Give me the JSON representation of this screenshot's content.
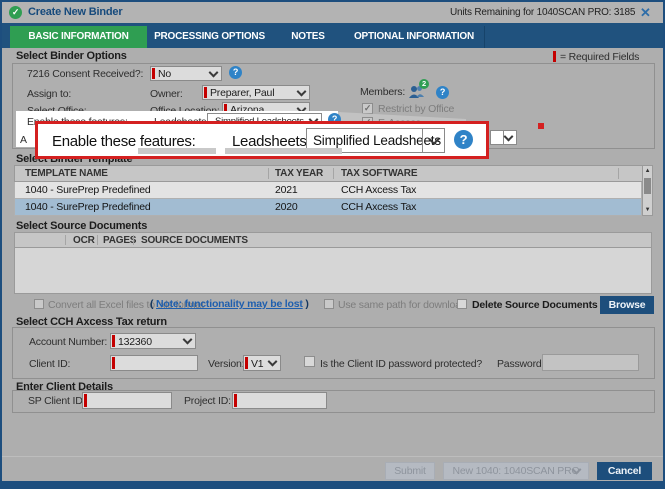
{
  "window": {
    "title": "Create New Binder",
    "units_label": "Units Remaining for 1040SCAN PRO: 3185",
    "close_glyph": "✕",
    "check_glyph": "✓"
  },
  "tabs": {
    "basic": "BASIC INFORMATION",
    "processing": "PROCESSING OPTIONS",
    "notes": "NOTES",
    "optional": "OPTIONAL INFORMATION"
  },
  "binder_options": {
    "heading": "Select Binder Options",
    "required_legend": "= Required Fields",
    "consent_label": "7216 Consent Received?:",
    "consent_value": "No",
    "assign_label": "Assign to:",
    "owner_label": "Owner:",
    "owner_value": "Preparer, Paul",
    "members_label": "Members:",
    "members_count": "2",
    "office_label": "Select Office:",
    "office_location_label": "Office Location:",
    "office_value": "Arizona",
    "restrict_label": "Restrict by Office",
    "features_label": "Enable these features:",
    "leadsheets_label": "Leadsheets:",
    "leadsheets_value": "Simplified Leadsheets",
    "eaccess_label": "E-Access",
    "hidden_row_fragment": "A",
    "check_glyph": "✓"
  },
  "callout": {
    "features_label": "Enable these features:",
    "leadsheets_label": "Leadsheets:",
    "leadsheets_value": "Simplified Leadsheets",
    "help_glyph": "?"
  },
  "template_section": {
    "heading": "Select Binder Template",
    "columns": {
      "name": "TEMPLATE NAME",
      "year": "TAX YEAR",
      "software": "TAX SOFTWARE"
    },
    "rows": [
      {
        "name": "1040 - SurePrep Predefined",
        "year": "2021",
        "software": "CCH Axcess Tax"
      },
      {
        "name": "1040 - SurePrep Predefined",
        "year": "2020",
        "software": "CCH Axcess Tax"
      }
    ],
    "selected_row_index": 1,
    "scroll_up_glyph": "▲",
    "scroll_down_glyph": "▼"
  },
  "source_section": {
    "heading": "Select Source Documents",
    "columns": {
      "ocr": "OCR",
      "pages": "PAGES",
      "docs": "SOURCE DOCUMENTS"
    },
    "convert_label": "Convert all Excel files to .xls format",
    "note_open": "(",
    "note_link": "Note: functionality may be lost",
    "note_close": ")",
    "samepath_label": "Use same path for download",
    "delete_label": "Delete Source Documents",
    "browse_label": "Browse"
  },
  "tax_return_section": {
    "heading": "Select CCH Axcess Tax return",
    "account_label": "Account Number:",
    "account_value": "132360",
    "client_id_label": "Client ID:",
    "version_label": "Version:",
    "version_value": "V1",
    "password_protected_label": "Is the Client ID password protected?",
    "password_label": "Password:"
  },
  "client_details_section": {
    "heading": "Enter Client Details",
    "sp_client_id_label": "SP Client ID:",
    "project_id_label": "Project ID:"
  },
  "footer": {
    "submit_label": "Submit",
    "binder_type_value": "New 1040: 1040SCAN PRO",
    "cancel_label": "Cancel"
  },
  "colors": {
    "navy": "#1d4e7e",
    "active_tab_green": "#2f9e52",
    "required_red": "#c40000",
    "callout_border_red": "#d42020",
    "help_blue": "#2f83c7",
    "selected_row_blue": "#a2bcd2"
  }
}
